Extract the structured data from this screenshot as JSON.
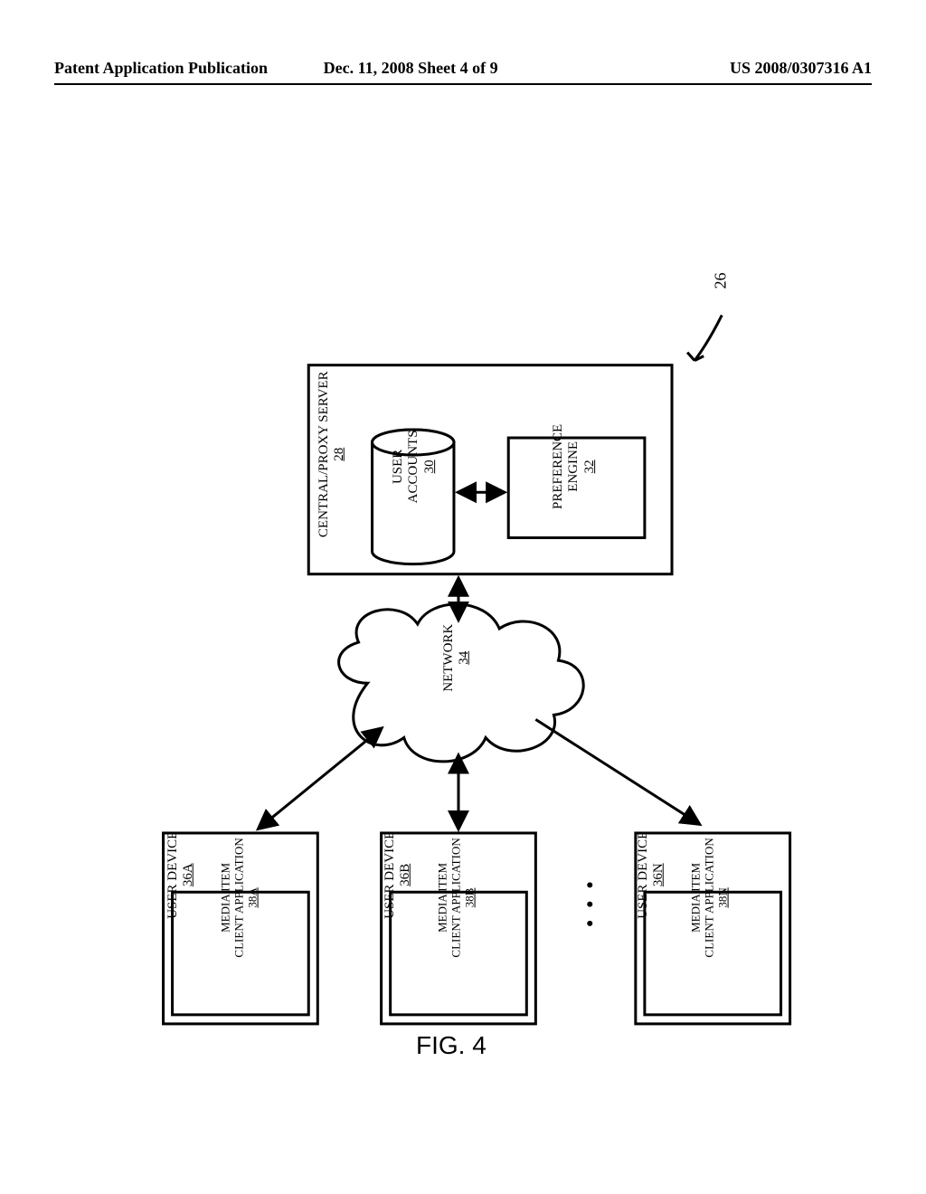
{
  "header": {
    "left": "Patent Application Publication",
    "mid": "Dec. 11, 2008  Sheet 4 of 9",
    "right": "US 2008/0307316 A1"
  },
  "ref_system": "26",
  "server": {
    "title": "CENTRAL/PROXY SERVER",
    "title_num": "28",
    "accounts": {
      "l1": "USER",
      "l2": "ACCOUNTS",
      "num": "30"
    },
    "engine": {
      "l1": "PREFERENCE",
      "l2": "ENGINE",
      "num": "32"
    }
  },
  "network": {
    "label": "NETWORK",
    "num": "34"
  },
  "devices": [
    {
      "title": "USER DEVICE",
      "title_num": "36A",
      "client": {
        "l1": "MEDIA ITEM",
        "l2": "CLIENT APPLICATION",
        "num": "38A"
      }
    },
    {
      "title": "USER DEVICE",
      "title_num": "36B",
      "client": {
        "l1": "MEDIA ITEM",
        "l2": "CLIENT APPLICATION",
        "num": "38B"
      }
    },
    {
      "title": "USER DEVICE",
      "title_num": "36N",
      "client": {
        "l1": "MEDIA ITEM",
        "l2": "CLIENT APPLICATION",
        "num": "38N"
      }
    }
  ],
  "ellipsis": "• • •",
  "figure": "FIG. 4"
}
